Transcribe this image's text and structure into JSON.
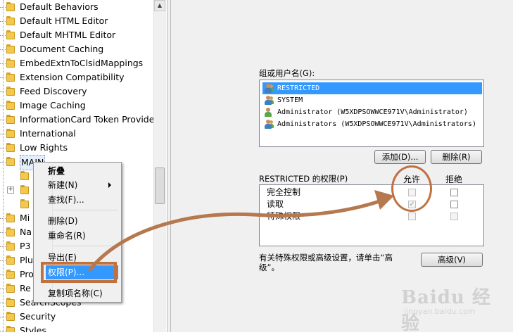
{
  "tree": {
    "items": [
      {
        "label": "Default Behaviors"
      },
      {
        "label": "Default HTML Editor"
      },
      {
        "label": "Default MHTML Editor"
      },
      {
        "label": "Document Caching"
      },
      {
        "label": "EmbedExtnToClsidMappings"
      },
      {
        "label": "Extension Compatibility"
      },
      {
        "label": "Feed Discovery"
      },
      {
        "label": "Image Caching"
      },
      {
        "label": "InformationCard Token Provider"
      },
      {
        "label": "International"
      },
      {
        "label": "Low Rights"
      },
      {
        "label": "MAIN"
      },
      {
        "label": "Mi"
      },
      {
        "label": "Na"
      },
      {
        "label": "P3"
      },
      {
        "label": "Plu"
      },
      {
        "label": "Pro"
      },
      {
        "label": "Re"
      },
      {
        "label": "SearchScopes"
      },
      {
        "label": "Security"
      },
      {
        "label": "Styles"
      }
    ]
  },
  "context_menu": {
    "items": [
      {
        "label": "折叠"
      },
      {
        "label": "新建(N)"
      },
      {
        "label": "查找(F)..."
      },
      {
        "label": "删除(D)"
      },
      {
        "label": "重命名(R)"
      },
      {
        "label": "导出(E)"
      },
      {
        "label": "权限(P)..."
      },
      {
        "label": "复制项名称(C)"
      }
    ]
  },
  "dialog": {
    "group_label": "组或用户名(G):",
    "users": [
      {
        "name": "RESTRICTED"
      },
      {
        "name": "SYSTEM"
      },
      {
        "name": "Administrator (W5XDPSOWWCE971V\\Administrator)"
      },
      {
        "name": "Administrators (W5XDPSOWWCE971V\\Administrators)"
      }
    ],
    "add_button": "添加(D)...",
    "remove_button": "删除(R)",
    "perm_header": "RESTRICTED 的权限(P)",
    "allow_header": "允许",
    "deny_header": "拒绝",
    "permissions": [
      {
        "name": "完全控制",
        "allow": false,
        "deny": false
      },
      {
        "name": "读取",
        "allow": true,
        "deny": false
      },
      {
        "name": "特殊权限",
        "allow": false,
        "deny": false
      }
    ],
    "advanced_hint_line1": "有关特殊权限或高级设置，请单击“高",
    "advanced_hint_line2": "级”。",
    "advanced_button": "高级(V)"
  },
  "watermark": {
    "brand": "Baidu 经验",
    "url": "jingyan.baidu.com"
  },
  "colors": {
    "annotation": "#c1713f",
    "selection": "#3399ff",
    "folder": "#f2c94c"
  }
}
